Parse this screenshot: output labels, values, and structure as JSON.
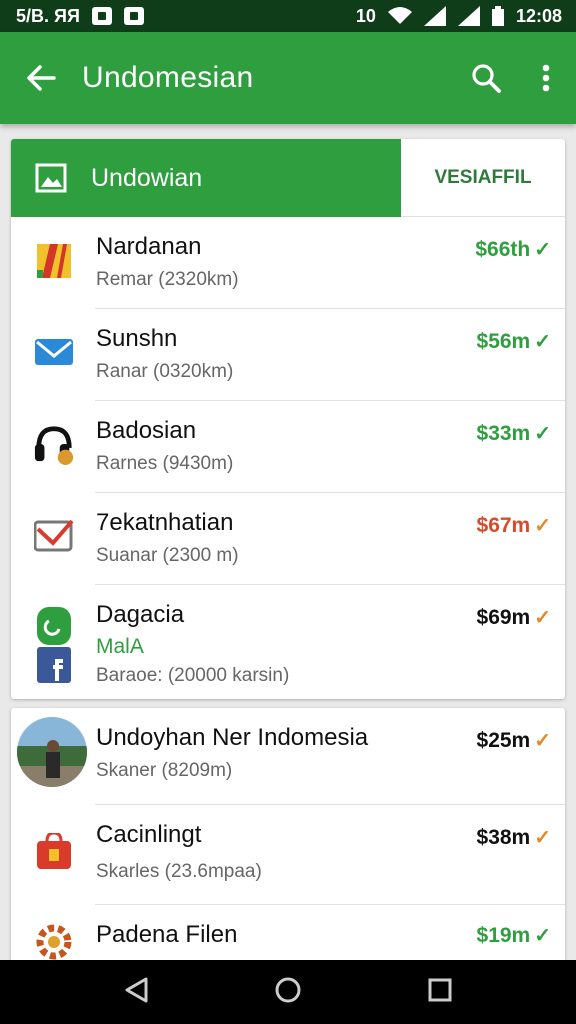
{
  "status_bar": {
    "carrier": "5/B. ЯЯ",
    "time": "12:08",
    "network": "10"
  },
  "app_bar": {
    "title": "Undomesian",
    "back_icon": "arrow-left-icon",
    "search_icon": "search-icon",
    "menu_icon": "more-vert-icon"
  },
  "tabs": {
    "active_label": "Undowian",
    "other_label": "VESIAFFIL"
  },
  "list1": [
    {
      "name": "Nardanan",
      "sub": "Remar (2320km)",
      "price": "$66th",
      "price_color": "green",
      "check_color": "green"
    },
    {
      "name": "Sunshn",
      "sub": "Ranar (0320km)",
      "price": "$56m",
      "price_color": "green",
      "check_color": "green"
    },
    {
      "name": "Badosian",
      "sub": "Rarnes (9430m)",
      "price": "$33m",
      "price_color": "green",
      "check_color": "green"
    },
    {
      "name": "7ekatnhatian",
      "sub": "Suanar (2300 m)",
      "price": "$67m",
      "price_color": "red",
      "check_color": "orange"
    },
    {
      "name": "Dagacia",
      "extra": "MalA",
      "sub": "Baraoe: (20000 karsin)",
      "price": "$69m",
      "price_color": "black",
      "check_color": "orange"
    }
  ],
  "list2": [
    {
      "name": "Undoyhan Ner Indomesia",
      "sub": "Skaner (8209m)",
      "price": "$25m",
      "price_color": "black",
      "check_color": "orange"
    },
    {
      "name": "Cacinlingt",
      "sub": "Skarles (23.6mpaa)",
      "price": "$38m",
      "price_color": "black",
      "check_color": "orange"
    },
    {
      "name": "Padena Filen",
      "sub": "",
      "price": "$19m",
      "price_color": "green",
      "check_color": "green"
    }
  ],
  "check_glyph": "✓"
}
